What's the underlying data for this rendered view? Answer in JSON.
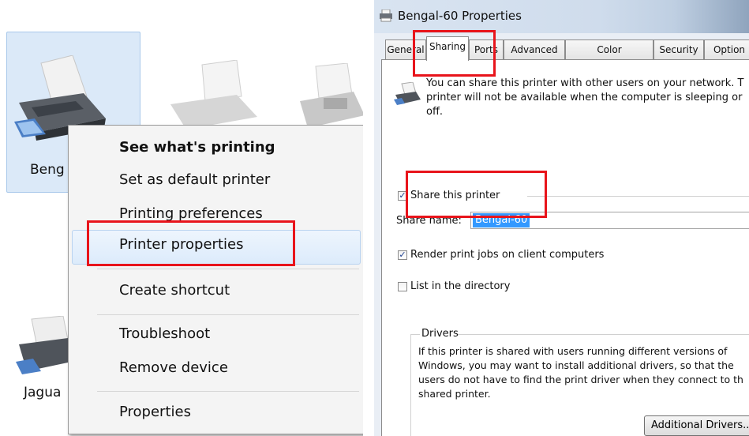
{
  "left_panel": {
    "devices": [
      {
        "label": "Beng"
      },
      {
        "label": "Jagua"
      }
    ],
    "context_menu": {
      "items": [
        {
          "label": "See what's printing"
        },
        {
          "label": "Set as default printer"
        },
        {
          "label": "Printing preferences"
        },
        {
          "label": "Printer properties"
        },
        {
          "label": "Create shortcut"
        },
        {
          "label": "Troubleshoot"
        },
        {
          "label": "Remove device"
        },
        {
          "label": "Properties"
        }
      ]
    }
  },
  "dialog": {
    "title": "Bengal-60 Properties",
    "tabs": [
      {
        "label": "General"
      },
      {
        "label": "Sharing"
      },
      {
        "label": "Ports"
      },
      {
        "label": "Advanced"
      },
      {
        "label": "Color Management"
      },
      {
        "label": "Security"
      },
      {
        "label": "Option"
      }
    ],
    "info_line1": "You can share this printer with other users on your network. T",
    "info_line2": "printer will not be available when the computer is sleeping or",
    "info_line3": "off.",
    "share_checkbox": {
      "label": "Share this printer",
      "checked": true
    },
    "share_name_label": "Share name:",
    "share_name_value": "Bengal-60",
    "render_checkbox": {
      "label": "Render print jobs on client computers",
      "checked": true
    },
    "list_checkbox": {
      "label": "List in the directory",
      "checked": false
    },
    "drivers_group": {
      "title": "Drivers",
      "line1": "If this printer is shared with users running different versions of",
      "line2": "Windows, you may want to install additional drivers, so that the",
      "line3": "users do not have to find the print driver when they connect to th",
      "line4": "shared printer.",
      "button": "Additional Drivers..."
    }
  },
  "colors": {
    "highlight_box": "#e8141b",
    "selection": "#3399ff"
  }
}
